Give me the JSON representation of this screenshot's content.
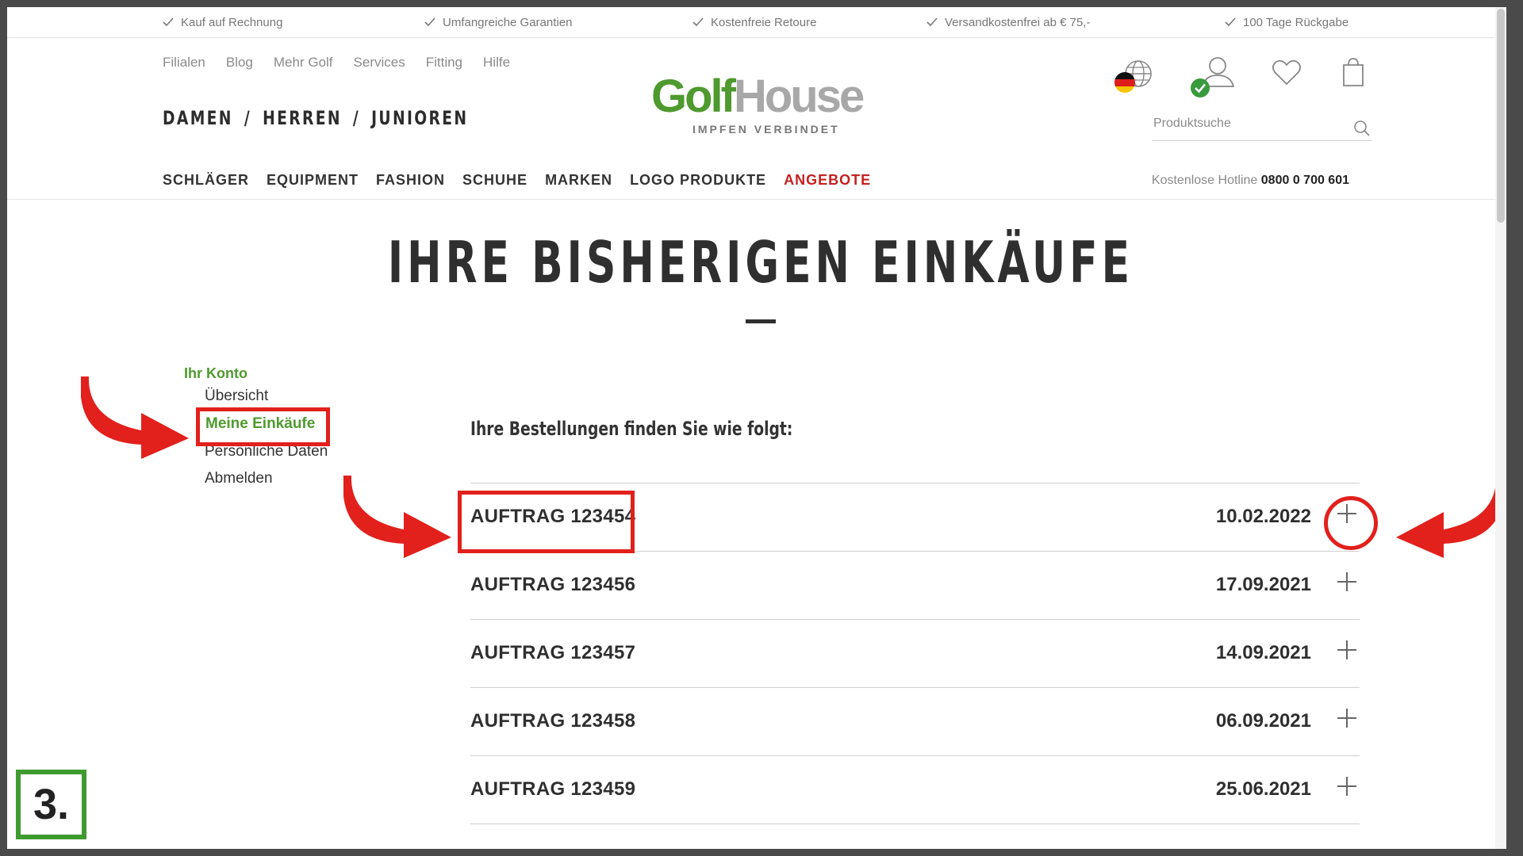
{
  "usp": [
    "Kauf auf Rechnung",
    "Umfangreiche Garantien",
    "Kostenfreie Retoure",
    "Versandkostenfrei ab € 75,-",
    "100 Tage Rückgabe"
  ],
  "meta_nav": [
    "Filialen",
    "Blog",
    "Mehr Golf",
    "Services",
    "Fitting",
    "Hilfe"
  ],
  "gender_nav": [
    "DAMEN",
    "HERREN",
    "JUNIOREN"
  ],
  "gender_sep": "/",
  "logo": {
    "golf": "Golf",
    "house": "House",
    "tagline": "IMPFEN VERBINDET"
  },
  "search": {
    "placeholder": "Produktsuche"
  },
  "main_nav": [
    "SCHLÄGER",
    "EQUIPMENT",
    "FASHION",
    "SCHUHE",
    "MARKEN",
    "LOGO PRODUKTE",
    "ANGEBOTE"
  ],
  "hotline": {
    "label": "Kostenlose Hotline",
    "number": "0800 0 700 601"
  },
  "page_title": "IHRE BISHERIGEN EINKÄUFE",
  "sidebar": {
    "heading": "Ihr Konto",
    "items": [
      "Übersicht",
      "Meine Einkäufe",
      "Persönliche Daten",
      "Abmelden"
    ],
    "active": "Meine Einkäufe"
  },
  "orders_intro": "Ihre Bestellungen finden Sie wie folgt:",
  "orders": [
    {
      "id": "AUFTRAG 123454",
      "date": "10.02.2022"
    },
    {
      "id": "AUFTRAG 123456",
      "date": "17.09.2021"
    },
    {
      "id": "AUFTRAG 123457",
      "date": "14.09.2021"
    },
    {
      "id": "AUFTRAG 123458",
      "date": "06.09.2021"
    },
    {
      "id": "AUFTRAG 123459",
      "date": "25.06.2021"
    }
  ],
  "step_badge": "3.",
  "colors": {
    "brand_green": "#4e9a2e",
    "sale_red": "#c4211f",
    "annotation_red": "#e2201c",
    "badge_green": "#3f9a30"
  },
  "icons": [
    "check-icon",
    "globe-icon",
    "german-flag-icon",
    "user-icon",
    "logged-in-check-icon",
    "heart-icon",
    "shopping-bag-icon",
    "search-icon",
    "plus-icon",
    "arrow-annotation"
  ]
}
